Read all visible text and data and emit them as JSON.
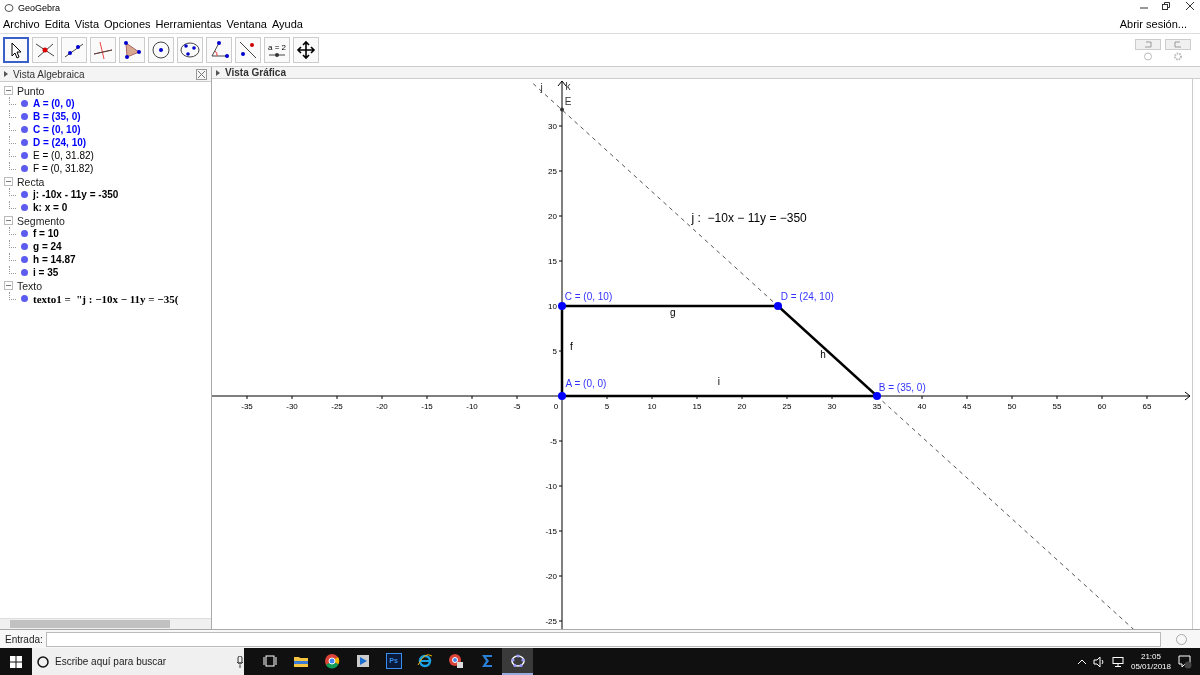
{
  "window": {
    "title": "GeoGebra",
    "sign_in": "Abrir sesión..."
  },
  "menu": [
    "Archivo",
    "Edita",
    "Vista",
    "Opciones",
    "Herramientas",
    "Ventana",
    "Ayuda"
  ],
  "tools": [
    {
      "kind": "pointer",
      "selected": true
    },
    {
      "kind": "point",
      "selected": false
    },
    {
      "kind": "line",
      "selected": false
    },
    {
      "kind": "perpendicular",
      "selected": false
    },
    {
      "kind": "polygon",
      "selected": false
    },
    {
      "kind": "circle",
      "selected": false
    },
    {
      "kind": "conic",
      "selected": false
    },
    {
      "kind": "angle",
      "selected": false
    },
    {
      "kind": "reflect",
      "selected": false
    },
    {
      "kind": "slider",
      "label": "a = 2",
      "selected": false
    },
    {
      "kind": "move",
      "selected": false
    }
  ],
  "algebra_view": {
    "title": "Vista Algebraica",
    "groups": [
      {
        "name": "Punto",
        "items": [
          {
            "text": "A = (0, 0)",
            "kind": "free"
          },
          {
            "text": "B = (35, 0)",
            "kind": "free"
          },
          {
            "text": "C = (0, 10)",
            "kind": "free"
          },
          {
            "text": "D = (24, 10)",
            "kind": "free"
          },
          {
            "text": "E = (0, 31.82)",
            "kind": "plain"
          },
          {
            "text": "F = (0, 31.82)",
            "kind": "plain"
          }
        ]
      },
      {
        "name": "Recta",
        "items": [
          {
            "text": "j: -10x - 11y = -350",
            "kind": "dependent"
          },
          {
            "text": "k: x = 0",
            "kind": "dependent"
          }
        ]
      },
      {
        "name": "Segmento",
        "items": [
          {
            "text": "f = 10",
            "kind": "dependent"
          },
          {
            "text": "g = 24",
            "kind": "dependent"
          },
          {
            "text": "h = 14.87",
            "kind": "dependent"
          },
          {
            "text": "i = 35",
            "kind": "dependent"
          }
        ]
      },
      {
        "name": "Texto",
        "items": [
          {
            "text": "texto1 =  \"j : −10x − 11y = −35(",
            "kind": "formula"
          }
        ]
      }
    ]
  },
  "graphics_view": {
    "title": "Vista Gráfica",
    "x_axis_labels": [
      "-35",
      "-30",
      "-25",
      "-20",
      "-15",
      "-10",
      "-5",
      "0",
      "5",
      "10",
      "15",
      "20",
      "25",
      "30",
      "35",
      "40",
      "45",
      "50",
      "55",
      "60",
      "65"
    ],
    "y_axis_labels": [
      "30",
      "25",
      "20",
      "15",
      "10",
      "5",
      "-5",
      "-10",
      "-15",
      "-20",
      "-25"
    ],
    "labels": [
      {
        "text": "A = (0, 0)",
        "kind": "free-point"
      },
      {
        "text": "B = (35, 0)",
        "kind": "free-point"
      },
      {
        "text": "C = (0, 10)",
        "kind": "free-point"
      },
      {
        "text": "D = (24, 10)",
        "kind": "free-point"
      },
      {
        "text": "E",
        "kind": "point"
      },
      {
        "text": "f",
        "kind": "object"
      },
      {
        "text": "g",
        "kind": "object"
      },
      {
        "text": "h",
        "kind": "object"
      },
      {
        "text": "i",
        "kind": "object"
      },
      {
        "text": "j",
        "kind": "point"
      },
      {
        "text": "k",
        "kind": "point"
      },
      {
        "text": "j :  −10x − 11y = −350",
        "kind": "caption"
      }
    ]
  },
  "input_bar": {
    "label": "Entrada:"
  },
  "taskbar": {
    "search_placeholder": "Escribe aquí para buscar",
    "apps": [
      {
        "kind": "taskview",
        "selected": false
      },
      {
        "kind": "folder",
        "selected": false
      },
      {
        "kind": "chrome",
        "selected": false
      },
      {
        "kind": "player",
        "selected": false
      },
      {
        "kind": "photoshop",
        "label": "Ps",
        "selected": false
      },
      {
        "kind": "ie",
        "selected": false
      },
      {
        "kind": "chrome-user",
        "selected": false
      },
      {
        "kind": "sigma",
        "selected": false
      },
      {
        "kind": "geogebra",
        "selected": true
      }
    ],
    "time": "21:05",
    "date": "05/01/2018"
  }
}
